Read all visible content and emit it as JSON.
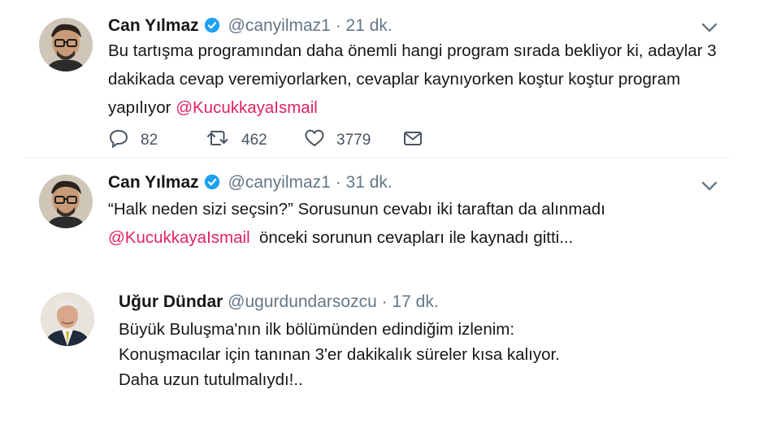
{
  "tweets": [
    {
      "name": "Can Yılmaz",
      "handle": "@canyilmaz1",
      "separator": "·",
      "time": "21 dk.",
      "lines": [
        "Bu tartışma programından daha önemli hangi program sırada bekliyor ki, adaylar 3",
        "dakikada cevap veremiyorlarken, cevaplar kaynıyorken koştur koştur program",
        "yapılıyor"
      ],
      "mention": "@KucukkayaIsmail",
      "replies": "82",
      "retweets": "462",
      "likes": "3779"
    },
    {
      "name": "Can Yılmaz",
      "handle": "@canyilmaz1",
      "separator": "·",
      "time": "31 dk.",
      "lines": [
        "“Halk neden sizi seçsin?” Sorusunun cevabı iki taraftan da alınmadı",
        "önceki sorunun cevapları ile kaynadı gitti..."
      ],
      "mention": "@KucukkayaIsmail"
    },
    {
      "name": "Uğur Dündar",
      "handle": "@ugurdundarsozcu",
      "separator": "·",
      "time": "17 dk.",
      "lines": [
        "Büyük Buluşma'nın ilk bölümünden edindiğim izlenim:",
        "Konuşmacılar için tanınan 3'er dakikalık süreler kısa kalıyor.",
        "Daha uzun tutulmalıydı!.."
      ]
    }
  ],
  "icons": {
    "verified": "verified-badge-icon",
    "caret": "chevron-down-icon",
    "reply": "reply-icon",
    "retweet": "retweet-icon",
    "like": "heart-icon",
    "dm": "envelope-icon"
  },
  "colors": {
    "mention": "#e0245e",
    "verified": "#1da1f2",
    "muted": "#657786"
  }
}
